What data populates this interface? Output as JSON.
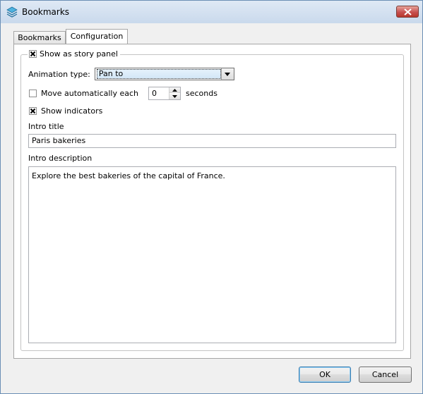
{
  "window": {
    "title": "Bookmarks"
  },
  "tabs": [
    {
      "label": "Bookmarks",
      "active": false
    },
    {
      "label": "Configuration",
      "active": true
    }
  ],
  "config": {
    "story_panel": {
      "label": "Show as story panel",
      "checked": true
    },
    "animation": {
      "label": "Animation type:",
      "value": "Pan to"
    },
    "move_auto": {
      "label": "Move automatically each",
      "checked": false,
      "value": "0",
      "unit_label": "seconds"
    },
    "show_indicators": {
      "label": "Show indicators",
      "checked": true
    },
    "intro_title": {
      "label": "Intro title",
      "value": "Paris bakeries"
    },
    "intro_description": {
      "label": "Intro description",
      "value": "Explore the best bakeries of the capital of France."
    }
  },
  "buttons": {
    "ok": "OK",
    "cancel": "Cancel"
  }
}
